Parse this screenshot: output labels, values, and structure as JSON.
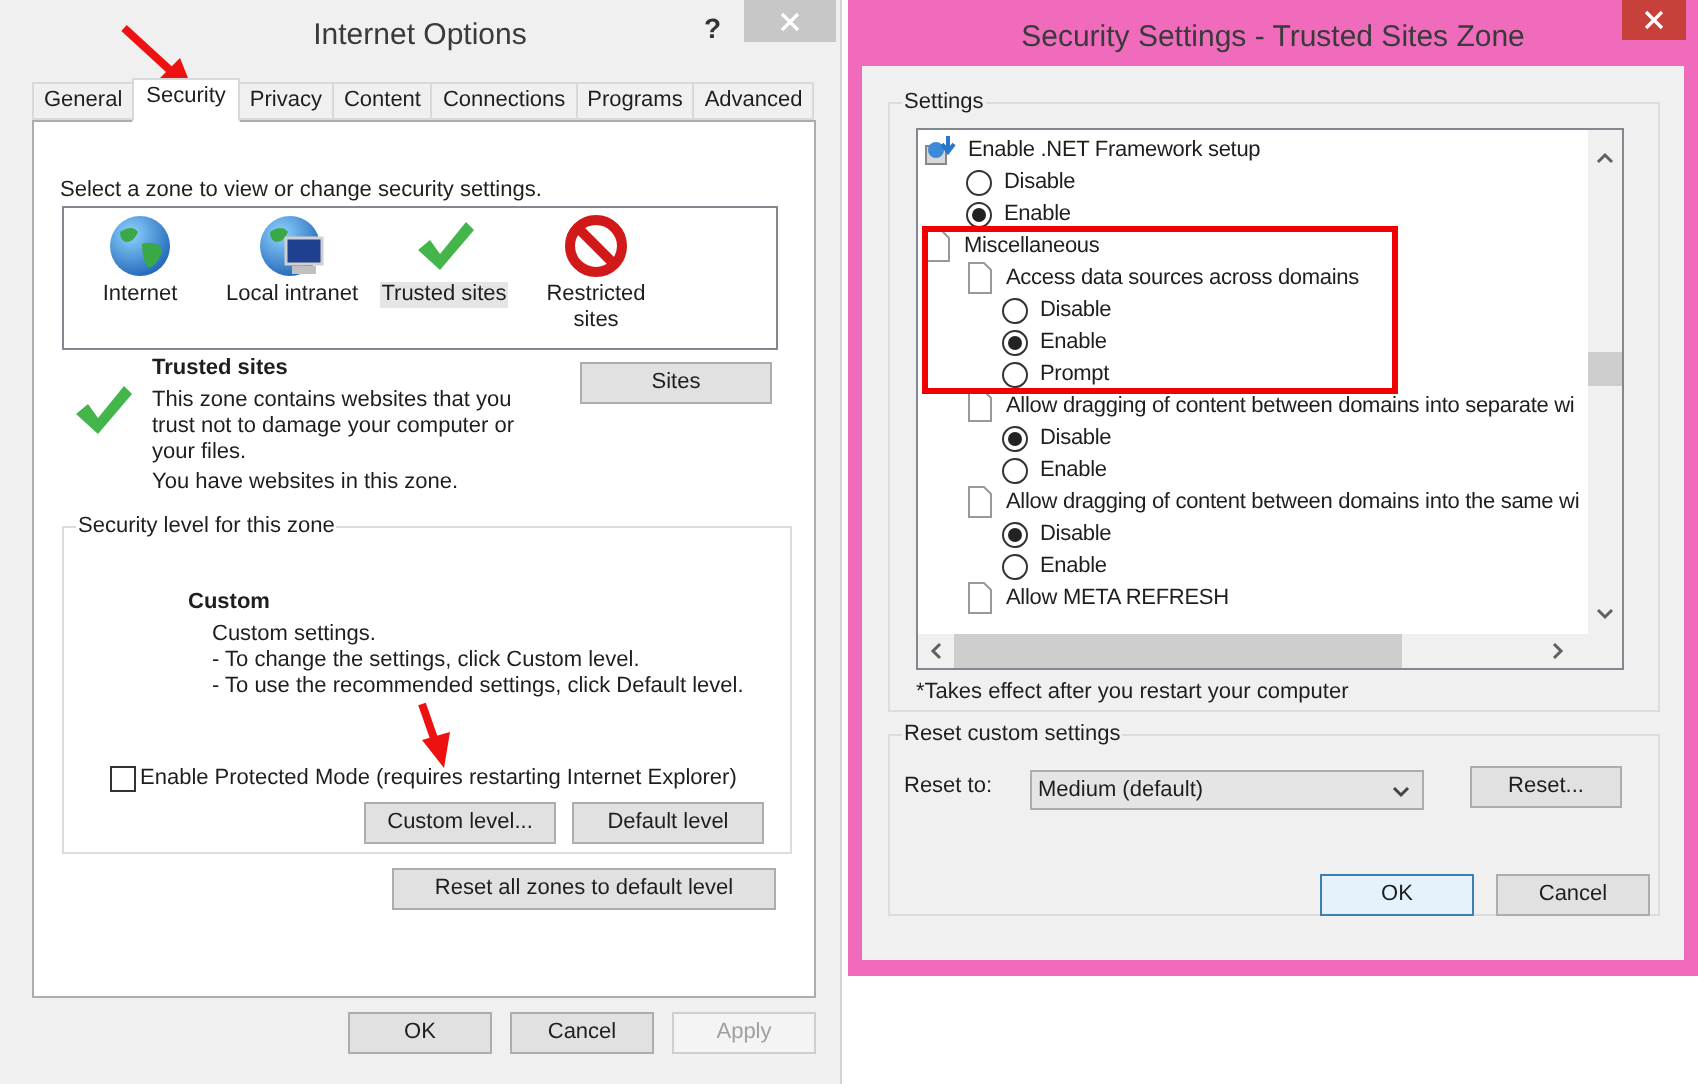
{
  "internet_options": {
    "title": "Internet Options",
    "help": "?",
    "tabs": [
      {
        "label": "General",
        "selected": false
      },
      {
        "label": "Security",
        "selected": true
      },
      {
        "label": "Privacy",
        "selected": false
      },
      {
        "label": "Content",
        "selected": false
      },
      {
        "label": "Connections",
        "selected": false
      },
      {
        "label": "Programs",
        "selected": false
      },
      {
        "label": "Advanced",
        "selected": false
      }
    ],
    "zone_prompt": "Select a zone to view or change security settings.",
    "zones": [
      {
        "label": "Internet",
        "kind": "globe",
        "selected": false
      },
      {
        "label": "Local intranet",
        "kind": "intranet",
        "selected": false
      },
      {
        "label": "Trusted sites",
        "kind": "trusted",
        "selected": true
      },
      {
        "label": "Restricted sites",
        "kind": "restricted",
        "selected": false
      }
    ],
    "zone_info": {
      "title": "Trusted sites",
      "description": "This zone contains websites that you trust not to damage your computer or your files.",
      "status": "You have websites in this zone.",
      "button": "Sites"
    },
    "security_level": {
      "legend": "Security level for this zone",
      "name": "Custom",
      "lines": [
        "Custom settings.",
        "- To change the settings, click Custom level.",
        "- To use the recommended settings, click Default level."
      ]
    },
    "protected_mode": {
      "label": "Enable Protected Mode (requires restarting Internet Explorer)",
      "checked": false
    },
    "level_buttons": [
      "Custom level...",
      "Default level"
    ],
    "reset_all_button": "Reset all zones to default level",
    "buttons": [
      {
        "label": "OK",
        "disabled": false
      },
      {
        "label": "Cancel",
        "disabled": false
      },
      {
        "label": "Apply",
        "disabled": true
      }
    ]
  },
  "security_settings": {
    "title": "Security Settings - Trusted Sites Zone",
    "settings_legend": "Settings",
    "tree": [
      {
        "label": "Enable .NET Framework setup",
        "kind": "component",
        "children": [
          {
            "label": "Disable",
            "kind": "option",
            "selected": false
          },
          {
            "label": "Enable",
            "kind": "option",
            "selected": true
          }
        ]
      },
      {
        "label": "Miscellaneous",
        "kind": "category",
        "children": [
          {
            "label": "Access data sources across domains",
            "kind": "setting",
            "children": [
              {
                "label": "Disable",
                "kind": "option",
                "selected": false
              },
              {
                "label": "Enable",
                "kind": "option",
                "selected": true
              },
              {
                "label": "Prompt",
                "kind": "option",
                "selected": false
              }
            ]
          },
          {
            "label": "Allow dragging of content between domains into separate wi",
            "kind": "setting",
            "children": [
              {
                "label": "Disable",
                "kind": "option",
                "selected": true
              },
              {
                "label": "Enable",
                "kind": "option",
                "selected": false
              }
            ]
          },
          {
            "label": "Allow dragging of content between domains into the same wi",
            "kind": "setting",
            "children": [
              {
                "label": "Disable",
                "kind": "option",
                "selected": true
              },
              {
                "label": "Enable",
                "kind": "option",
                "selected": false
              }
            ]
          },
          {
            "label": "Allow META REFRESH",
            "kind": "setting"
          }
        ]
      }
    ],
    "note": "*Takes effect after you restart your computer",
    "reset_legend": "Reset custom settings",
    "reset_to_label": "Reset to:",
    "reset_select": "Medium (default)",
    "reset_button": "Reset...",
    "buttons": [
      {
        "label": "OK",
        "default": true
      },
      {
        "label": "Cancel",
        "default": false
      }
    ]
  }
}
